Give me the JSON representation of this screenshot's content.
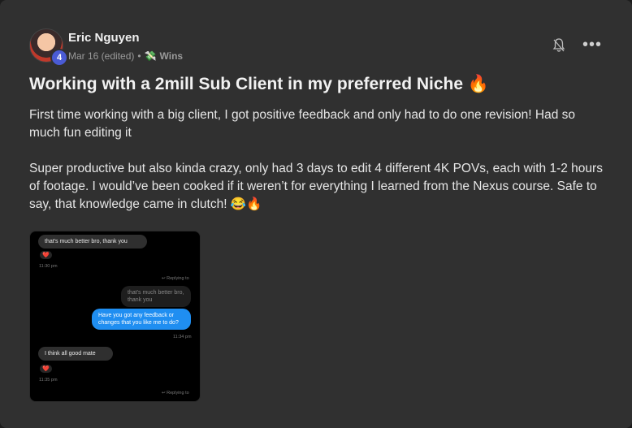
{
  "author": {
    "name": "Eric Nguyen",
    "level": "4"
  },
  "meta": {
    "date": "Mar 16 (edited)",
    "separator": "•",
    "category": "Wins",
    "category_icon": "💸"
  },
  "icons": {
    "bell": "bell-icon",
    "more": "•••"
  },
  "post": {
    "title": "Working with a 2mill Sub Client in my preferred Niche 🔥",
    "para1": "First time working with a big client, I got positive feedback and only had to do one revision! Had so much fun editing it",
    "para2": "Super productive but also kinda crazy, only had 3 days to edit 4 different 4K POVs, each with 1-2 hours of footage. I would’ve been cooked if it weren’t for everything I learned from the Nexus course. Safe to say, that knowledge came in clutch! 😂🔥"
  },
  "chat": {
    "msg1": "that's much better bro, thank you",
    "heart": "❤️",
    "time1": "11:30 pm",
    "replying1": "↩ Replying to",
    "quote": "that's much better bro, thank you",
    "msg2": "Have you got any feedback or changes that you like me to do?",
    "time2": "11:34 pm",
    "msg3": "I think all good mate",
    "time3": "11:35 pm",
    "replying2": "↩ Replying to"
  }
}
